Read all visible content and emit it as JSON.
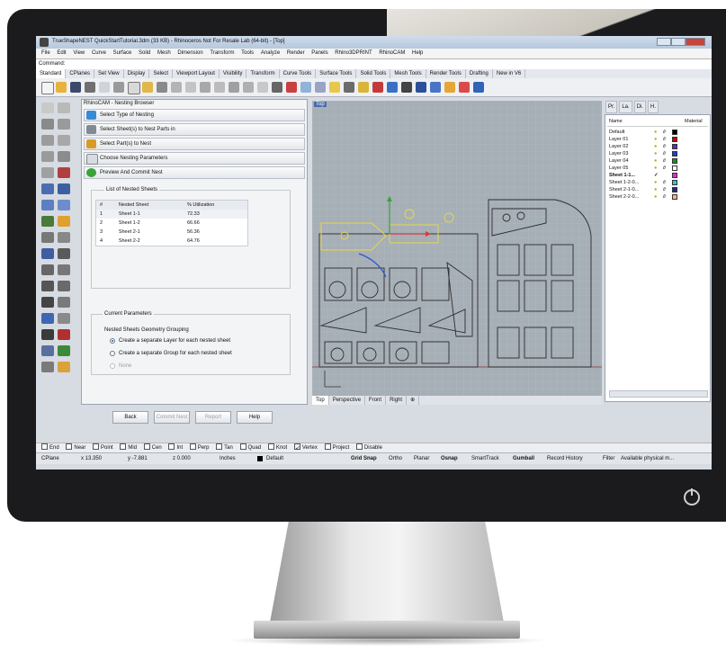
{
  "window": {
    "title": "TrueShapeNEST QuickStartTutorial.3dm (33 KB) - Rhinoceros Not For Resale Lab (64-bit) - [Top]"
  },
  "menu": [
    "File",
    "Edit",
    "View",
    "Curve",
    "Surface",
    "Solid",
    "Mesh",
    "Dimension",
    "Transform",
    "Tools",
    "Analyze",
    "Render",
    "Panels",
    "Rhino3DPRINT",
    "RhinoCAM",
    "Help"
  ],
  "command": {
    "label": "Command:"
  },
  "toolbar_tabs": [
    "Standard",
    "CPlanes",
    "Set View",
    "Display",
    "Select",
    "Viewport Layout",
    "Visibility",
    "Transform",
    "Curve Tools",
    "Surface Tools",
    "Solid Tools",
    "Mesh Tools",
    "Render Tools",
    "Drafting",
    "New in V6"
  ],
  "panel": {
    "title": "RhinoCAM - Nesting Browser",
    "steps": [
      "Select Type of Nesting",
      "Select Sheet(s) to Nest Parts in",
      "Select Part(s) to Nest",
      "Choose Nesting Parameters",
      "Preview And Commit Nest"
    ],
    "nested_list": {
      "title": "List of Nested Sheets",
      "columns": [
        "#",
        "Nested Sheet",
        "% Utilization"
      ],
      "rows": [
        [
          "1",
          "Sheet 1-1",
          "72.33"
        ],
        [
          "2",
          "Sheet 1-2",
          "66.66"
        ],
        [
          "3",
          "Sheet 2-1",
          "56.36"
        ],
        [
          "4",
          "Sheet 2-2",
          "64.76"
        ]
      ]
    },
    "current_parameters": {
      "title": "Current Parameters",
      "grouping_title": "Nested Sheets Geometry Grouping",
      "options": [
        "Create a separate Layer for each nested sheet",
        "Create a separate Group for each nested sheet",
        "None"
      ],
      "selected": 0
    },
    "buttons": {
      "back": "Back",
      "commit": "Commit Nest",
      "report": "Report",
      "help": "Help"
    }
  },
  "viewport": {
    "label": "Top",
    "tabs": [
      "Top",
      "Perspective",
      "Front",
      "Right"
    ]
  },
  "layers": {
    "tabs": [
      "Pr.",
      "La.",
      "Di.",
      "H."
    ],
    "header": {
      "name": "Name",
      "material": "Material"
    },
    "rows": [
      {
        "name": "Default",
        "color": "#000000"
      },
      {
        "name": "Layer 01",
        "color": "#cc0000"
      },
      {
        "name": "Layer 02",
        "color": "#5a2bd6"
      },
      {
        "name": "Layer 03",
        "color": "#1a3fd6"
      },
      {
        "name": "Layer 04",
        "color": "#1f8a2a"
      },
      {
        "name": "Layer 05",
        "color": "#ffffff"
      },
      {
        "name": "Sheet 1-1...",
        "color": "#e02bd8"
      },
      {
        "name": "Sheet 1-2-0...",
        "color": "#2bc6d9"
      },
      {
        "name": "Sheet 2-1-0...",
        "color": "#1a2a7a"
      },
      {
        "name": "Sheet 2-2-0...",
        "color": "#f2b48a"
      }
    ]
  },
  "osnap": [
    "End",
    "Near",
    "Point",
    "Mid",
    "Cen",
    "Int",
    "Perp",
    "Tan",
    "Quad",
    "Knot",
    "Vertex",
    "Project",
    "Disable"
  ],
  "osnap_checked": [
    "Vertex"
  ],
  "status": {
    "cplane": "CPlane",
    "x": "x 13.350",
    "y": "y -7.881",
    "z": "z 0.000",
    "units": "Inches",
    "layer": "Default",
    "toggles": [
      "Grid Snap",
      "Ortho",
      "Planar",
      "Osnap",
      "SmartTrack",
      "Gumball",
      "Record History",
      "Filter"
    ],
    "message": "Available physical m..."
  },
  "colors": {
    "accent": "#2b5aa8",
    "viewport_bg": "#a6aeb6",
    "selected_curve": "#e5d84a"
  }
}
